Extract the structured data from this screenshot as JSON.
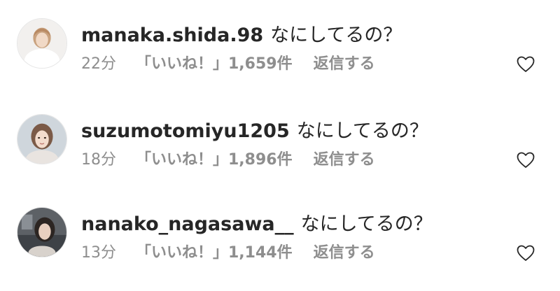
{
  "comments": [
    {
      "username": "manaka.shida.98",
      "text": "なにしてるの？",
      "time": "22分",
      "likes": "「いいね！」1,659件",
      "reply": "返信する",
      "avatar_icon": "profile-photo",
      "heart_icon": "heart-outline-icon"
    },
    {
      "username": "suzumotomiyu1205",
      "text": "なにしてるの？",
      "time": "18分",
      "likes": "「いいね！」1,896件",
      "reply": "返信する",
      "avatar_icon": "profile-photo",
      "heart_icon": "heart-outline-icon"
    },
    {
      "username": "nanako_nagasawa__",
      "text": "なにしてるの？",
      "time": "13分",
      "likes": "「いいね！」1,144件",
      "reply": "返信する",
      "avatar_icon": "profile-photo",
      "heart_icon": "heart-outline-icon"
    }
  ],
  "colors": {
    "text_primary": "#262626",
    "text_secondary": "#8e8e8e",
    "background": "#ffffff"
  }
}
